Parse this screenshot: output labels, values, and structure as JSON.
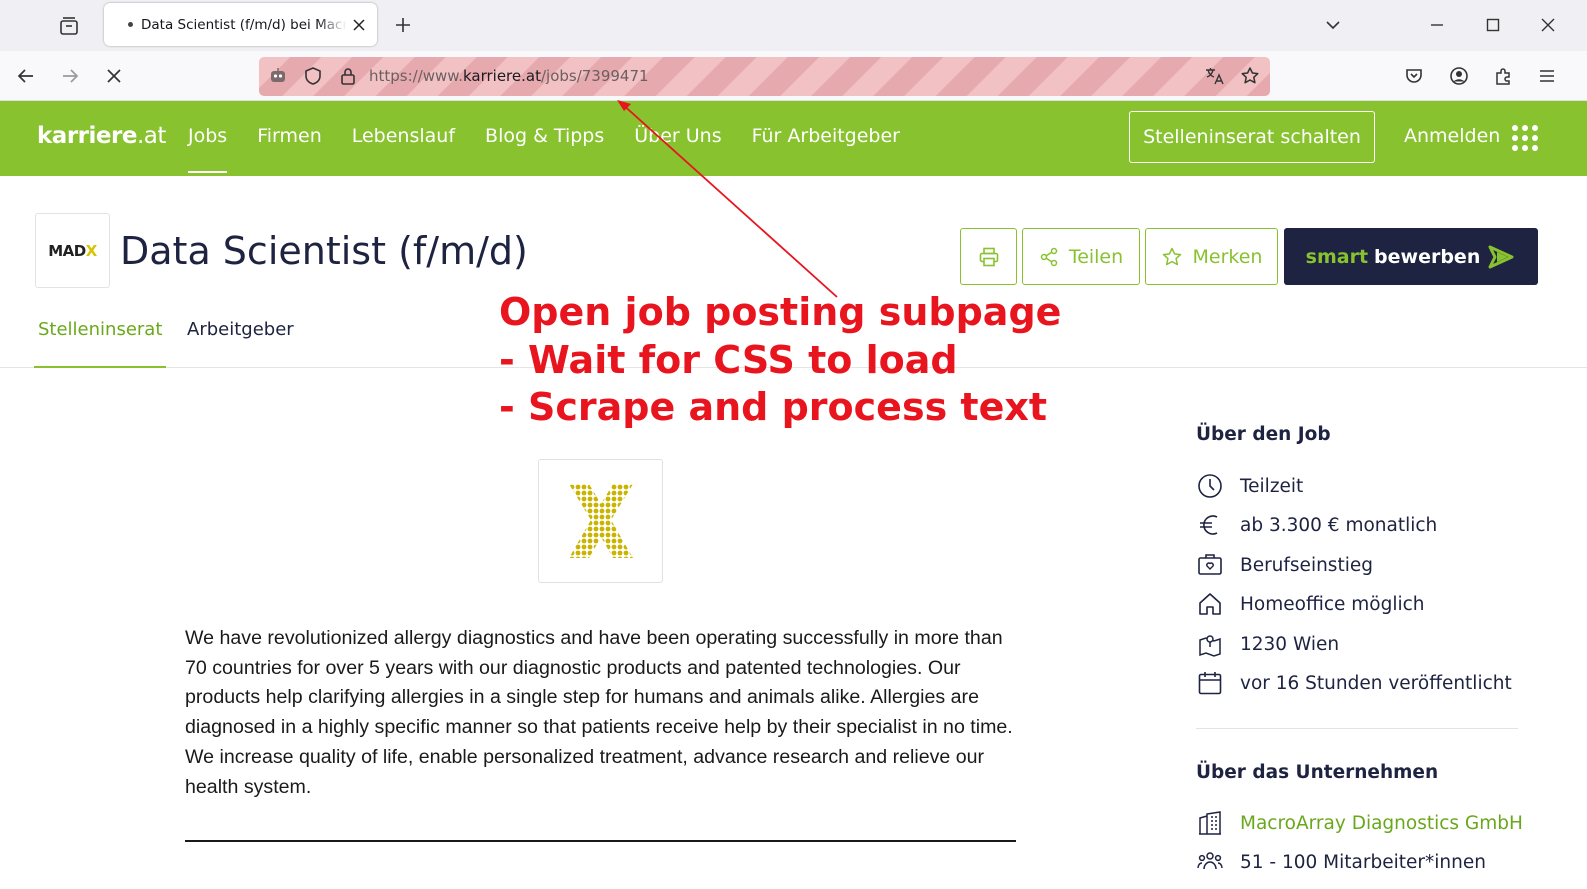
{
  "browser": {
    "tab_title": "Data Scientist (f/m/d) bei MacroArray",
    "url_prefix": "https://www.",
    "url_host": "karriere.at",
    "url_path": "/jobs/7399471"
  },
  "site": {
    "logo_main": "karriere",
    "logo_suffix": ".at",
    "nav": [
      "Jobs",
      "Firmen",
      "Lebenslauf",
      "Blog & Tipps",
      "Über Uns",
      "Für Arbeitgeber"
    ],
    "post_button": "Stelleninserat schalten",
    "login": "Anmelden",
    "brand_color": "#88c22f",
    "dark_color": "#1d2340"
  },
  "job": {
    "company_logo_text": "MAD",
    "company_logo_x": "X",
    "title": "Data Scientist (f/m/d)",
    "share_label": "Teilen",
    "save_label": "Merken",
    "apply_smart": "smart",
    "apply_label": "bewerben",
    "tabs": [
      "Stelleninserat",
      "Arbeitgeber"
    ],
    "description": "We have revolutionized allergy diagnostics and have been operating successfully in more than 70 countries for over 5 years with our diagnostic products and patented technologies. Our products help clarifying allergies in a single step for humans and animals alike.  Allergies are diagnosed in a highly specific manner so that patients receive help by their specialist in no time. We increase quality of life, enable personalized treatment, advance research and relieve our health system."
  },
  "annotation": {
    "lines": [
      "Open job posting subpage",
      "- Wait for CSS to load",
      "- Scrape and process text"
    ],
    "color": "#e8141e"
  },
  "sidebar": {
    "job_heading": "Über den Job",
    "job_items": [
      {
        "icon": "clock-icon",
        "text": "Teilzeit"
      },
      {
        "icon": "euro-icon",
        "text": "ab 3.300 € monatlich"
      },
      {
        "icon": "briefcase-icon",
        "text": "Berufseinstieg"
      },
      {
        "icon": "home-icon",
        "text": "Homeoffice möglich"
      },
      {
        "icon": "map-pin-icon",
        "text": "1230 Wien"
      },
      {
        "icon": "calendar-icon",
        "text": "vor 16 Stunden veröffentlicht"
      }
    ],
    "company_heading": "Über das Unternehmen",
    "company_items": [
      {
        "icon": "building-icon",
        "text": "MacroArray Diagnostics GmbH"
      },
      {
        "icon": "people-icon",
        "text": "51 - 100 Mitarbeiter*innen"
      }
    ]
  }
}
